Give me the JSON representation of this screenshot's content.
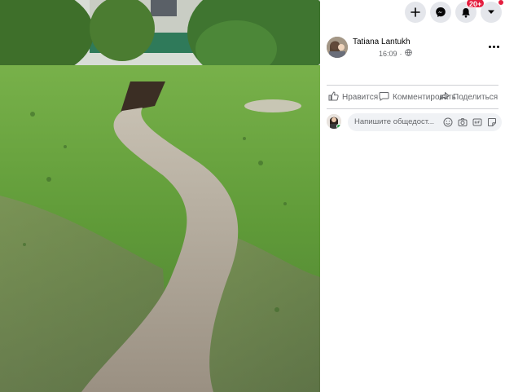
{
  "topbar": {
    "buttons": [
      {
        "icon": "plus-icon"
      },
      {
        "icon": "messenger-icon"
      },
      {
        "icon": "bell-icon",
        "badge": "20+"
      },
      {
        "icon": "chevron-down-icon",
        "dot": true
      }
    ]
  },
  "post": {
    "author": "Tatiana Lantukh",
    "time": "16:09",
    "time_separator": "·",
    "privacy_icon": "globe-icon",
    "more_icon": "more-icon"
  },
  "actions": {
    "like": "Нравится",
    "comment": "Комментировать",
    "share": "Поделиться"
  },
  "comment_box": {
    "placeholder": "Напишите общедост...",
    "icons": [
      "emoji-icon",
      "camera-icon",
      "gif-icon",
      "sticker-icon"
    ]
  },
  "colors": {
    "badge": "#e41e3f",
    "online": "#31a24c",
    "secondary_text": "#65676b",
    "button_bg": "#e4e6eb"
  }
}
